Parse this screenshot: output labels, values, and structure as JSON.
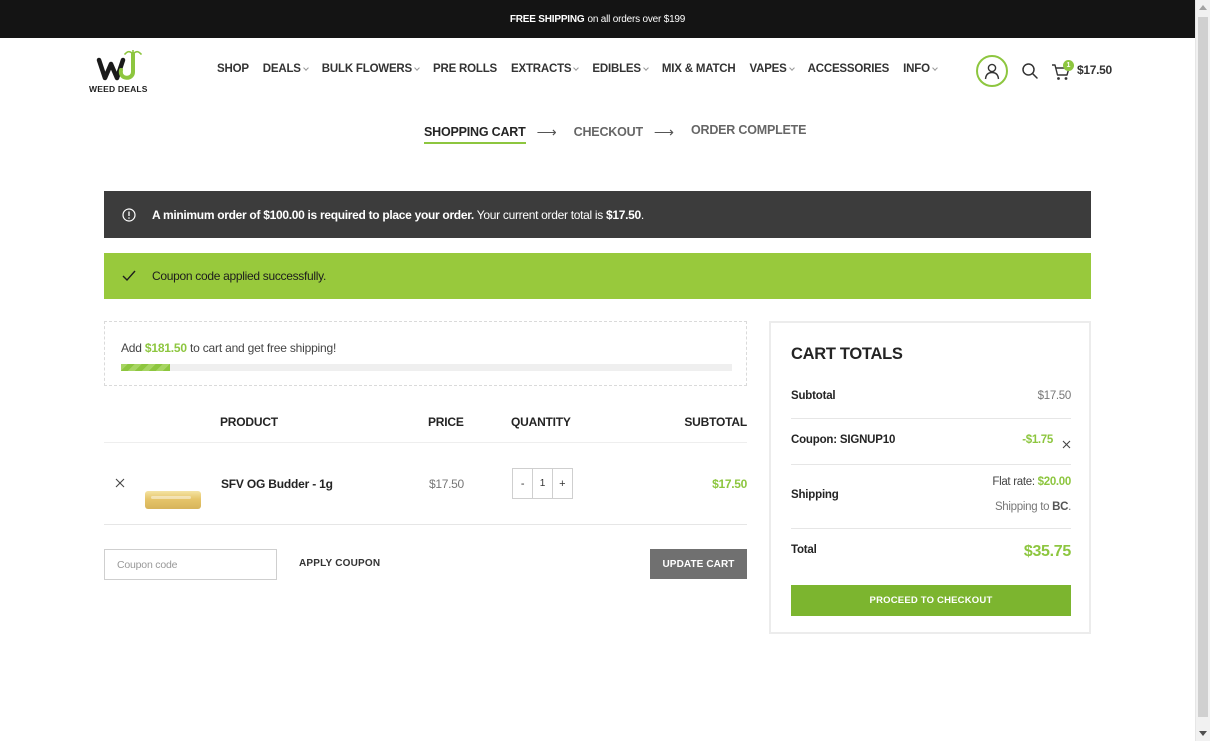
{
  "topbar": {
    "bold": "FREE SHIPPING",
    "rest": "on all orders over $199"
  },
  "logo": {
    "text": "WEED DEALS"
  },
  "nav": [
    {
      "label": "SHOP",
      "dropdown": false
    },
    {
      "label": "DEALS",
      "dropdown": true
    },
    {
      "label": "BULK FLOWERS",
      "dropdown": true
    },
    {
      "label": "PRE ROLLS",
      "dropdown": false
    },
    {
      "label": "EXTRACTS",
      "dropdown": true
    },
    {
      "label": "EDIBLES",
      "dropdown": true
    },
    {
      "label": "MIX & MATCH",
      "dropdown": false
    },
    {
      "label": "VAPES",
      "dropdown": true
    },
    {
      "label": "ACCESSORIES",
      "dropdown": false
    },
    {
      "label": "INFO",
      "dropdown": true
    }
  ],
  "header": {
    "cart_count": "1",
    "cart_amount": "$17.50"
  },
  "steps": {
    "s1": "SHOPPING CART",
    "s2": "CHECKOUT",
    "s3": "ORDER COMPLETE",
    "arrow": "⟶"
  },
  "notices": {
    "minimum_bold": "A minimum order of $100.00 is required to place your order.",
    "minimum_rest": " Your current order total is ",
    "minimum_total": "$17.50",
    "minimum_end": ".",
    "coupon_msg": "Coupon code applied successfully."
  },
  "free_shipping": {
    "pre": "Add ",
    "amount": "$181.50",
    "post": " to cart and get free shipping!",
    "progress_percent": 8
  },
  "table": {
    "headers": {
      "product": "PRODUCT",
      "price": "PRICE",
      "quantity": "QUANTITY",
      "subtotal": "SUBTOTAL"
    },
    "items": [
      {
        "name": "SFV OG Budder - 1g",
        "price": "$17.50",
        "qty": "1",
        "subtotal": "$17.50"
      }
    ],
    "minus": "-",
    "plus": "+"
  },
  "coupon": {
    "placeholder": "Coupon code",
    "apply_label": "APPLY COUPON",
    "update_label": "UPDATE CART"
  },
  "totals": {
    "title": "CART TOTALS",
    "subtotal_label": "Subtotal",
    "subtotal_value": "$17.50",
    "coupon_label": "Coupon: SIGNUP10",
    "coupon_value": "-$1.75",
    "shipping_label": "Shipping",
    "flat_rate_label": "Flat rate: ",
    "flat_rate_value": "$20.00",
    "shipping_to_label": "Shipping to ",
    "shipping_to_value": "BC",
    "shipping_to_end": ".",
    "total_label": "Total",
    "total_value": "$35.75",
    "checkout_label": "PROCEED TO CHECKOUT"
  },
  "colors": {
    "accent": "#8dc63f",
    "dark_notice": "#3c3c3c",
    "green_notice": "#98c93c",
    "topbar": "#141414"
  }
}
